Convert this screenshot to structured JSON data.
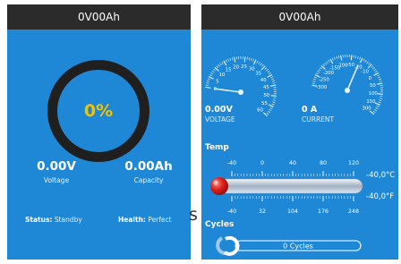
{
  "left": {
    "title": "0V00Ah",
    "progress_percent": 0,
    "progress_label": "0%",
    "voltage_value": "0.00V",
    "voltage_label": "Voltage",
    "capacity_value": "0.00Ah",
    "capacity_label": "Capacity",
    "status_label": "Status:",
    "status_value": "Standby",
    "health_label": "Health:",
    "health_value": "Perfect"
  },
  "edge_letter": "s",
  "right": {
    "title": "0V00Ah",
    "voltage_gauge": {
      "ticks": [
        "0",
        "5",
        "10",
        "15",
        "20",
        "25",
        "30",
        "35",
        "40",
        "45",
        "50",
        "55",
        "60"
      ],
      "reading": "0.00V",
      "label": "VOLTAGE"
    },
    "current_gauge": {
      "ticks": [
        "-300",
        "-250",
        "-200",
        "-150",
        "-100",
        "-50",
        "-20",
        "-10",
        "0",
        "50",
        "100",
        "150",
        "300"
      ],
      "reading": "0 A",
      "label": "CURRENT"
    },
    "temp": {
      "heading": "Temp",
      "celsius_ticks": [
        "-40",
        "0",
        "40",
        "80",
        "120"
      ],
      "fahrenheit_ticks": [
        "-40",
        "32",
        "104",
        "176",
        "248"
      ],
      "celsius_reading": "-40,0°C",
      "fahrenheit_reading": "-40,0°F"
    },
    "cycles": {
      "heading": "Cycles",
      "value": "0 Cycles"
    }
  },
  "colors": {
    "panel_bg": "#1e88d6",
    "titlebar_bg": "#2b2b2b",
    "percent_text": "#f2c200",
    "ring": "#1f1f1f",
    "thermo_bulb": "#e0201b"
  }
}
